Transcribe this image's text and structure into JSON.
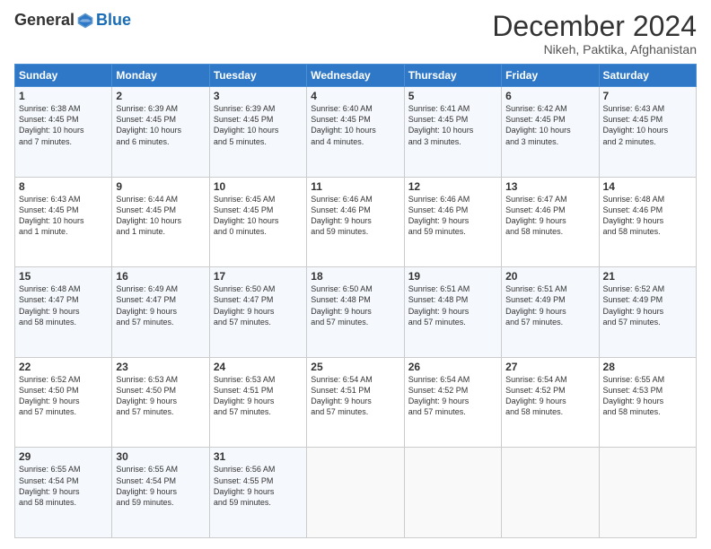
{
  "header": {
    "logo_general": "General",
    "logo_blue": "Blue",
    "month_title": "December 2024",
    "location": "Nikeh, Paktika, Afghanistan"
  },
  "days_of_week": [
    "Sunday",
    "Monday",
    "Tuesday",
    "Wednesday",
    "Thursday",
    "Friday",
    "Saturday"
  ],
  "weeks": [
    [
      {
        "day": 1,
        "info": "Sunrise: 6:38 AM\nSunset: 4:45 PM\nDaylight: 10 hours\nand 7 minutes."
      },
      {
        "day": 2,
        "info": "Sunrise: 6:39 AM\nSunset: 4:45 PM\nDaylight: 10 hours\nand 6 minutes."
      },
      {
        "day": 3,
        "info": "Sunrise: 6:39 AM\nSunset: 4:45 PM\nDaylight: 10 hours\nand 5 minutes."
      },
      {
        "day": 4,
        "info": "Sunrise: 6:40 AM\nSunset: 4:45 PM\nDaylight: 10 hours\nand 4 minutes."
      },
      {
        "day": 5,
        "info": "Sunrise: 6:41 AM\nSunset: 4:45 PM\nDaylight: 10 hours\nand 3 minutes."
      },
      {
        "day": 6,
        "info": "Sunrise: 6:42 AM\nSunset: 4:45 PM\nDaylight: 10 hours\nand 3 minutes."
      },
      {
        "day": 7,
        "info": "Sunrise: 6:43 AM\nSunset: 4:45 PM\nDaylight: 10 hours\nand 2 minutes."
      }
    ],
    [
      {
        "day": 8,
        "info": "Sunrise: 6:43 AM\nSunset: 4:45 PM\nDaylight: 10 hours\nand 1 minute."
      },
      {
        "day": 9,
        "info": "Sunrise: 6:44 AM\nSunset: 4:45 PM\nDaylight: 10 hours\nand 1 minute."
      },
      {
        "day": 10,
        "info": "Sunrise: 6:45 AM\nSunset: 4:45 PM\nDaylight: 10 hours\nand 0 minutes."
      },
      {
        "day": 11,
        "info": "Sunrise: 6:46 AM\nSunset: 4:46 PM\nDaylight: 9 hours\nand 59 minutes."
      },
      {
        "day": 12,
        "info": "Sunrise: 6:46 AM\nSunset: 4:46 PM\nDaylight: 9 hours\nand 59 minutes."
      },
      {
        "day": 13,
        "info": "Sunrise: 6:47 AM\nSunset: 4:46 PM\nDaylight: 9 hours\nand 58 minutes."
      },
      {
        "day": 14,
        "info": "Sunrise: 6:48 AM\nSunset: 4:46 PM\nDaylight: 9 hours\nand 58 minutes."
      }
    ],
    [
      {
        "day": 15,
        "info": "Sunrise: 6:48 AM\nSunset: 4:47 PM\nDaylight: 9 hours\nand 58 minutes."
      },
      {
        "day": 16,
        "info": "Sunrise: 6:49 AM\nSunset: 4:47 PM\nDaylight: 9 hours\nand 57 minutes."
      },
      {
        "day": 17,
        "info": "Sunrise: 6:50 AM\nSunset: 4:47 PM\nDaylight: 9 hours\nand 57 minutes."
      },
      {
        "day": 18,
        "info": "Sunrise: 6:50 AM\nSunset: 4:48 PM\nDaylight: 9 hours\nand 57 minutes."
      },
      {
        "day": 19,
        "info": "Sunrise: 6:51 AM\nSunset: 4:48 PM\nDaylight: 9 hours\nand 57 minutes."
      },
      {
        "day": 20,
        "info": "Sunrise: 6:51 AM\nSunset: 4:49 PM\nDaylight: 9 hours\nand 57 minutes."
      },
      {
        "day": 21,
        "info": "Sunrise: 6:52 AM\nSunset: 4:49 PM\nDaylight: 9 hours\nand 57 minutes."
      }
    ],
    [
      {
        "day": 22,
        "info": "Sunrise: 6:52 AM\nSunset: 4:50 PM\nDaylight: 9 hours\nand 57 minutes."
      },
      {
        "day": 23,
        "info": "Sunrise: 6:53 AM\nSunset: 4:50 PM\nDaylight: 9 hours\nand 57 minutes."
      },
      {
        "day": 24,
        "info": "Sunrise: 6:53 AM\nSunset: 4:51 PM\nDaylight: 9 hours\nand 57 minutes."
      },
      {
        "day": 25,
        "info": "Sunrise: 6:54 AM\nSunset: 4:51 PM\nDaylight: 9 hours\nand 57 minutes."
      },
      {
        "day": 26,
        "info": "Sunrise: 6:54 AM\nSunset: 4:52 PM\nDaylight: 9 hours\nand 57 minutes."
      },
      {
        "day": 27,
        "info": "Sunrise: 6:54 AM\nSunset: 4:52 PM\nDaylight: 9 hours\nand 58 minutes."
      },
      {
        "day": 28,
        "info": "Sunrise: 6:55 AM\nSunset: 4:53 PM\nDaylight: 9 hours\nand 58 minutes."
      }
    ],
    [
      {
        "day": 29,
        "info": "Sunrise: 6:55 AM\nSunset: 4:54 PM\nDaylight: 9 hours\nand 58 minutes."
      },
      {
        "day": 30,
        "info": "Sunrise: 6:55 AM\nSunset: 4:54 PM\nDaylight: 9 hours\nand 59 minutes."
      },
      {
        "day": 31,
        "info": "Sunrise: 6:56 AM\nSunset: 4:55 PM\nDaylight: 9 hours\nand 59 minutes."
      },
      null,
      null,
      null,
      null
    ]
  ]
}
